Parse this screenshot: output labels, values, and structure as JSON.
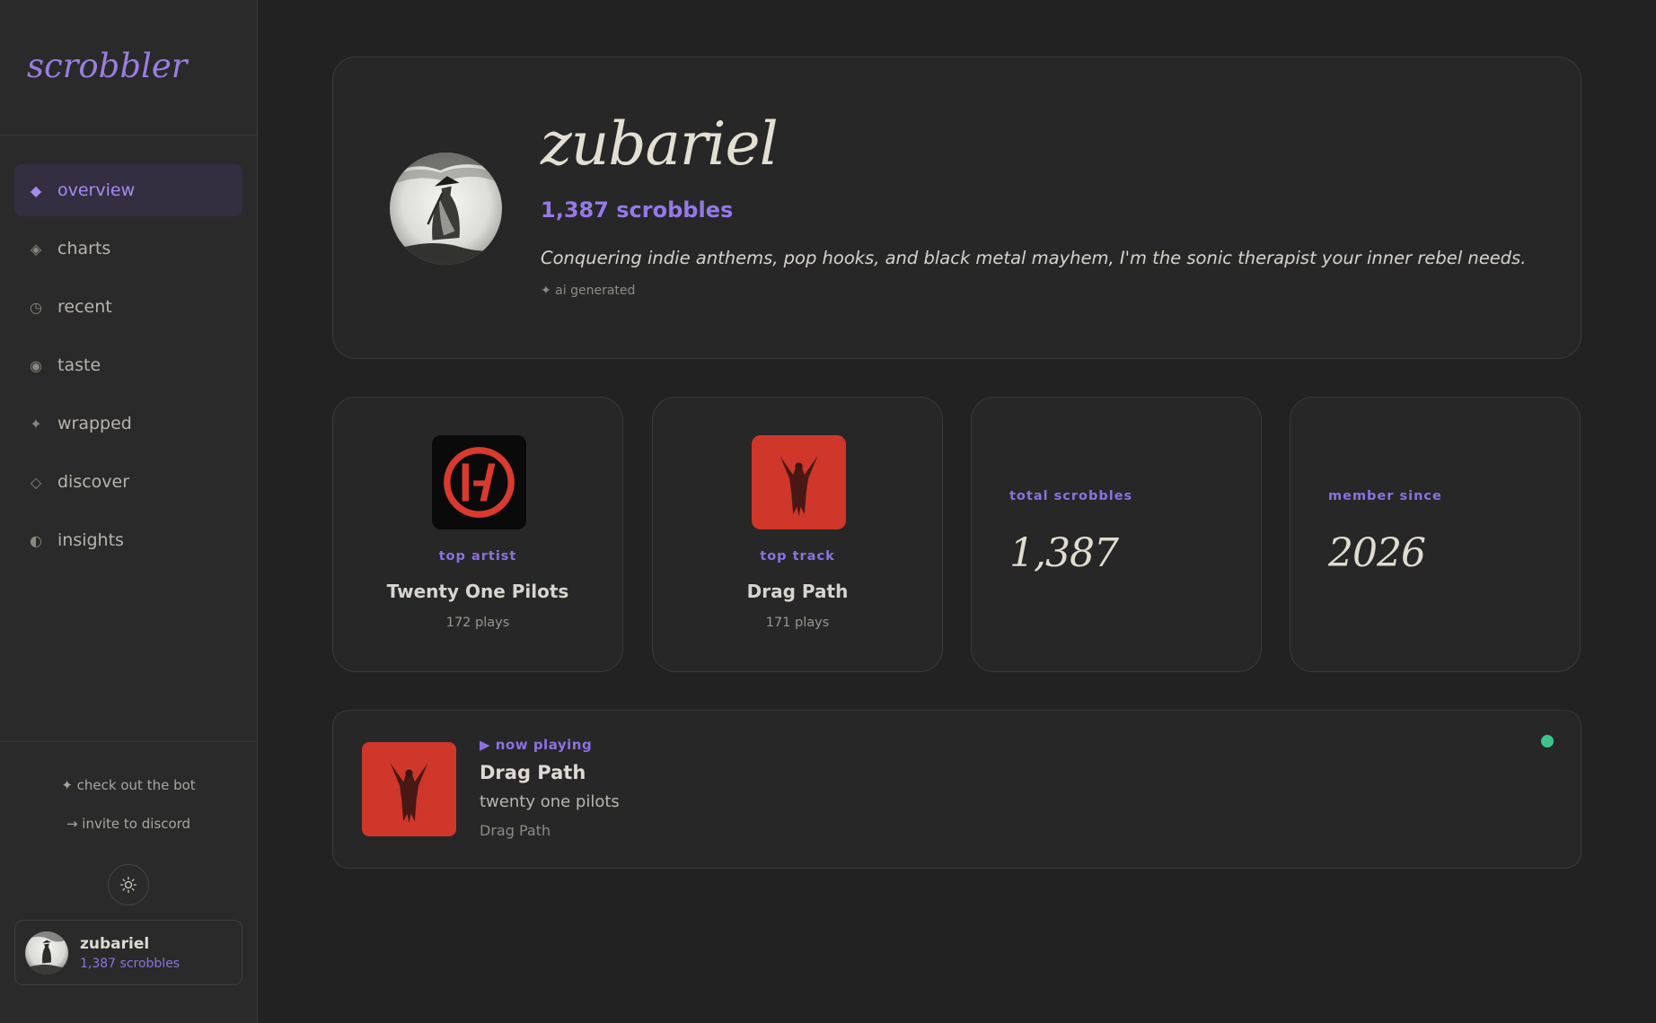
{
  "brand": "scrobbler",
  "nav": [
    {
      "label": "overview",
      "icon": "◆",
      "icon_name": "diamond-filled-icon",
      "active": true
    },
    {
      "label": "charts",
      "icon": "◈",
      "icon_name": "diamond-outline-icon"
    },
    {
      "label": "recent",
      "icon": "◷",
      "icon_name": "clock-icon"
    },
    {
      "label": "taste",
      "icon": "◉",
      "icon_name": "target-icon"
    },
    {
      "label": "wrapped",
      "icon": "✦",
      "icon_name": "sparkle-icon"
    },
    {
      "label": "discover",
      "icon": "◇",
      "icon_name": "diamond-empty-icon"
    },
    {
      "label": "insights",
      "icon": "◐",
      "icon_name": "half-circle-icon"
    }
  ],
  "sidebar_links": {
    "bot": "✦ check out the bot",
    "invite": "→ invite to discord"
  },
  "theme_toggle_icon": "sun-icon",
  "user": {
    "name": "zubariel",
    "scrobbles": "1,387 scrobbles"
  },
  "profile": {
    "name": "zubariel",
    "scrobbles": "1,387 scrobbles",
    "bio": "Conquering indie anthems, pop hooks, and black metal mayhem, I'm the sonic therapist your inner rebel needs.",
    "ai_note": "✦ ai generated"
  },
  "stats": {
    "top_artist": {
      "label": "top artist",
      "title": "Twenty One Pilots",
      "sub": "172 plays"
    },
    "top_track": {
      "label": "top track",
      "title": "Drag Path",
      "sub": "171 plays"
    },
    "total": {
      "label": "total scrobbles",
      "value": "1,387"
    },
    "member": {
      "label": "member since",
      "value": "2026"
    }
  },
  "now_playing": {
    "label": "▶ now playing",
    "track": "Drag Path",
    "artist": "twenty one pilots",
    "album": "Drag Path"
  },
  "colors": {
    "accent": "#9678e8",
    "background": "#222222",
    "sidebar": "#2a2a2a",
    "card": "#272727",
    "album_red": "#d0382c",
    "live_dot": "#3ec48a"
  }
}
